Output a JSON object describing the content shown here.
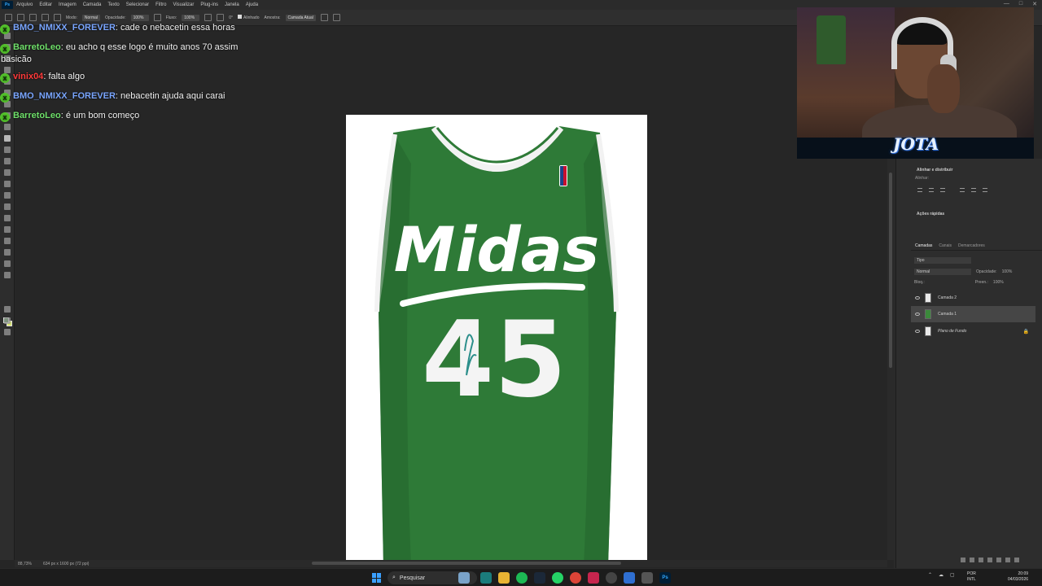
{
  "menubar": {
    "items": [
      "Arquivo",
      "Editar",
      "Imagem",
      "Camada",
      "Texto",
      "Selecionar",
      "Filtro",
      "Visualizar",
      "Plug-ins",
      "Janela",
      "Ajuda"
    ],
    "logo": "Ps"
  },
  "options": {
    "mode_label": "Modo:",
    "mode_value": "Normal",
    "opacity_label": "Opacidade:",
    "opacity_value": "100%",
    "flow_label": "Fluxo:",
    "flow_value": "100%",
    "angle_value": "0°",
    "aligned_label": "Alinhado",
    "sample_label": "Amostra:",
    "sample_value": "Camada Atual"
  },
  "chat": {
    "messages": [
      {
        "user": "BMO_NMIXX_FOREVER",
        "text": "cade o nebacetin essa horas",
        "color": "#7aa6ff",
        "badge": "x"
      },
      {
        "user": "BarretoLeo",
        "text": "eu acho q esse logo é muito anos 70 assim",
        "continuation": "basicão",
        "color": "#6fe06a",
        "badge": "x"
      },
      {
        "user": "vinix04",
        "text": "falta algo",
        "color": "#ff3a3a",
        "badge": "x"
      },
      {
        "user": "BMO_NMIXX_FOREVER",
        "text": "nebacetin ajuda aqui carai",
        "color": "#7aa6ff",
        "badge": "x"
      },
      {
        "user": "BarretoLeo",
        "text": "é um bom começo",
        "color": "#6fe06a",
        "badge": "x"
      }
    ]
  },
  "jersey": {
    "wordmark": "Midas",
    "number": "45",
    "color": "#2e7a37"
  },
  "webcam": {
    "logo_text": "JOTA"
  },
  "status": {
    "zoom": "88,73%",
    "size": "634 px x 1600 px (72 ppi)"
  },
  "panels": {
    "align_title": "Alinhar e distribuir",
    "align_sub": "Alinhar:",
    "quick_actions_title": "Ações rápidas",
    "tabs": [
      "Camadas",
      "Canais",
      "Demarcadores"
    ],
    "kind_label": "Tipo",
    "blend_mode": "Normal",
    "opacity_label": "Opacidade:",
    "opacity_value": "100%",
    "lock_label": "Bloq.:",
    "fill_label": "Preen.:",
    "fill_value": "100%",
    "layers": [
      {
        "name": "Camada 2",
        "thumb": "white",
        "selected": false,
        "locked": false
      },
      {
        "name": "Camada 1",
        "thumb": "green",
        "selected": true,
        "locked": false
      },
      {
        "name": "Plano de Fundo",
        "thumb": "white",
        "selected": false,
        "locked": true
      }
    ]
  },
  "taskbar": {
    "search_placeholder": "Pesquisar",
    "lang_top": "POR",
    "lang_bottom": "INTL",
    "time": "20:09",
    "date": "04/03/2026"
  }
}
